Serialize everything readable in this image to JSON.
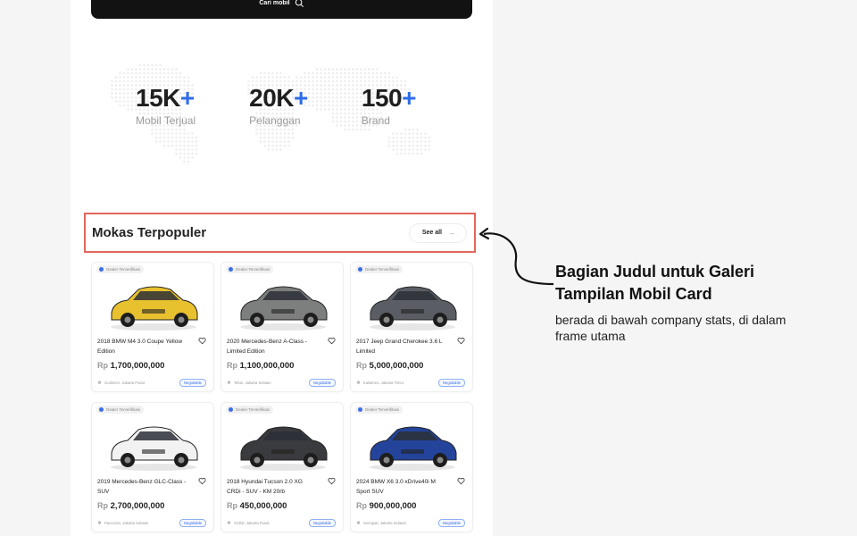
{
  "search": {
    "label": "Cari mobil"
  },
  "stats": [
    {
      "value": "15K",
      "suffix": "+",
      "label": "Mobil Terjual"
    },
    {
      "value": "20K",
      "suffix": "+",
      "label": "Pelanggan"
    },
    {
      "value": "150",
      "suffix": "+",
      "label": "Brand"
    }
  ],
  "section": {
    "title": "Mokas Terpopuler",
    "see_all": "See all"
  },
  "cards": [
    {
      "badge": "Dealer Terverifikasi",
      "title": "2018 BMW M4 3.0 Coupe Yellow Edition",
      "rp": "Rp",
      "price": "1,700,000,000",
      "location": "Gudimen, Jakarta Pusat",
      "tag": "Negotiable",
      "car_color": "#e8c12e"
    },
    {
      "badge": "Dealer Terverifikasi",
      "title": "2020 Mercedes-Benz A-Class - Limited Edition",
      "rp": "Rp",
      "price": "1,100,000,000",
      "location": "Tebet, Jakarta Selatan",
      "tag": "Negotiable",
      "car_color": "#7d7f7e"
    },
    {
      "badge": "Dealer Terverifikasi",
      "title": "2017 Jeep Grand Cherokee 3.6 L Limited",
      "rp": "Rp",
      "price": "5,000,000,000",
      "location": "Kalideres, Jakarta Timur",
      "tag": "Negotiable",
      "car_color": "#5a5e64"
    },
    {
      "badge": "Dealer Terverifikasi",
      "title": "2019 Mercedes-Benz GLC-Class - SUV",
      "rp": "Rp",
      "price": "2,700,000,000",
      "location": "Pancoran, Jakarta Selatan",
      "tag": "Negotiable",
      "car_color": "#f2f2f2"
    },
    {
      "badge": "Dealer Terverifikasi",
      "title": "2018 Hyundai Tucson 2.0 XG CRDi - SUV - KM 20rb",
      "rp": "Rp",
      "price": "450,000,000",
      "location": "SCBD, Jakarta Pusat",
      "tag": "Negotiable",
      "car_color": "#3a3b3e"
    },
    {
      "badge": "Dealer Terverifikasi",
      "title": "2024 BMW X6 3.0 xDrive40i M Sport SUV",
      "rp": "Rp",
      "price": "900,000,000",
      "location": "Senopati, Jakarta Selatan",
      "tag": "Negotiable",
      "car_color": "#24449c"
    }
  ],
  "annotation": {
    "title": "Bagian Judul untuk Galeri Tampilan Mobil Card",
    "description": "berada di bawah company stats, di dalam frame utama"
  }
}
